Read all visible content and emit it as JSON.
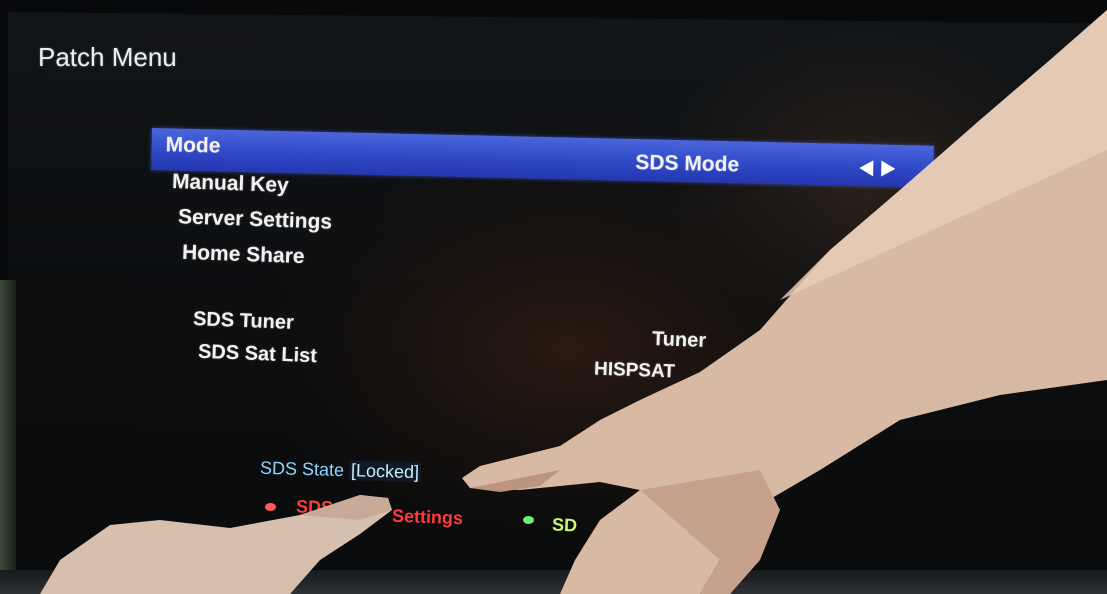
{
  "screen": {
    "title": "Patch Menu"
  },
  "menu": {
    "selected": {
      "label": "Mode",
      "value": "SDS Mode"
    },
    "items": [
      {
        "label": "Manual Key"
      },
      {
        "label": "Server Settings"
      },
      {
        "label": "Home Share"
      }
    ],
    "sds_tuner": {
      "label": "SDS Tuner",
      "value": "Tuner"
    },
    "sds_sat_list": {
      "label": "SDS Sat List",
      "value": "HISPSAT"
    }
  },
  "status": {
    "prefix": "SDS State",
    "state": "[Locked]"
  },
  "footer": {
    "red_part1": "SDS",
    "red_part2": "Settings",
    "green_part": "SD"
  },
  "colors": {
    "highlight": "#3550cc",
    "red_key": "#ff3b3b",
    "green_key": "#c9f56f",
    "state_text": "#8fd6ff"
  },
  "icons": {
    "value_arrows": "left-right-arrows-icon",
    "red_key": "red-dot-icon",
    "green_key": "green-dot-icon"
  }
}
